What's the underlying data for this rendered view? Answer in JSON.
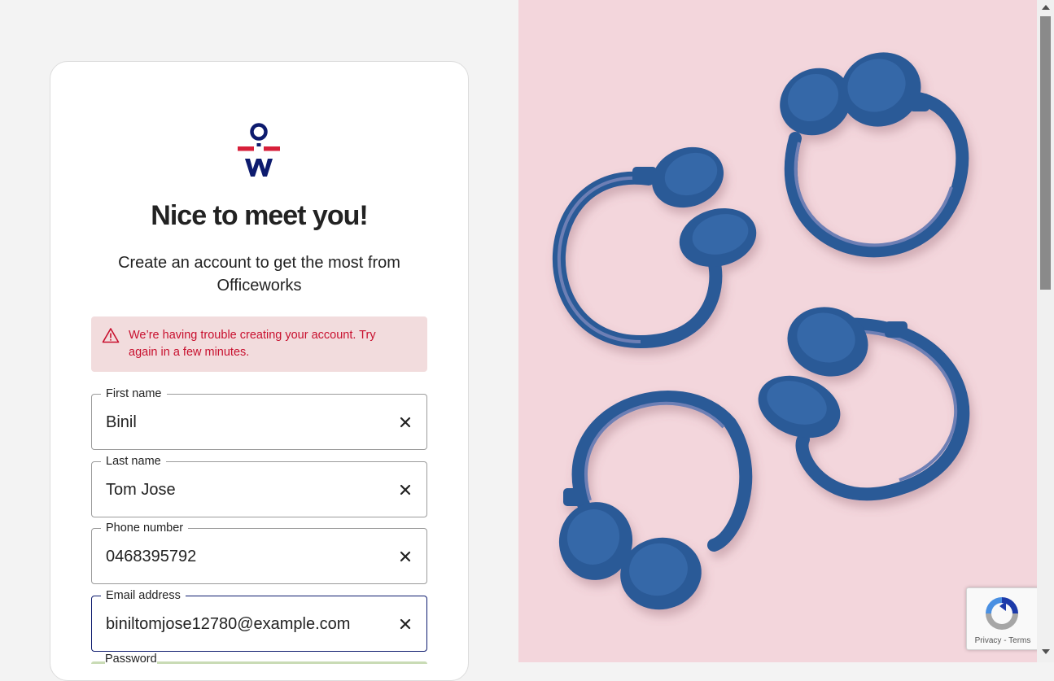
{
  "card": {
    "title": "Nice to meet you!",
    "subtitle": "Create an account to get the most from Officeworks"
  },
  "alert": {
    "message": "We’re having trouble creating your account. Try again in a few minutes."
  },
  "fields": {
    "first_name": {
      "label": "First name",
      "value": "Binil"
    },
    "last_name": {
      "label": "Last name",
      "value": "Tom Jose"
    },
    "phone": {
      "label": "Phone number",
      "value": "0468395792"
    },
    "email": {
      "label": "Email address",
      "value": "biniltomjose12780@example.com"
    },
    "password": {
      "label": "Password"
    }
  },
  "recaptcha": {
    "privacy": "Privacy",
    "separator": " - ",
    "terms": "Terms"
  },
  "colors": {
    "brand_navy": "#0d1b6e",
    "brand_red": "#d71f3a",
    "error_text": "#c8102e",
    "error_bg": "#f2dcdd",
    "hero_bg": "#f3d6dc",
    "headphone_blue": "#2c5a97"
  },
  "icons": {
    "logo": "officeworks-logo",
    "alert": "warning-triangle-icon",
    "clear": "close-icon"
  }
}
